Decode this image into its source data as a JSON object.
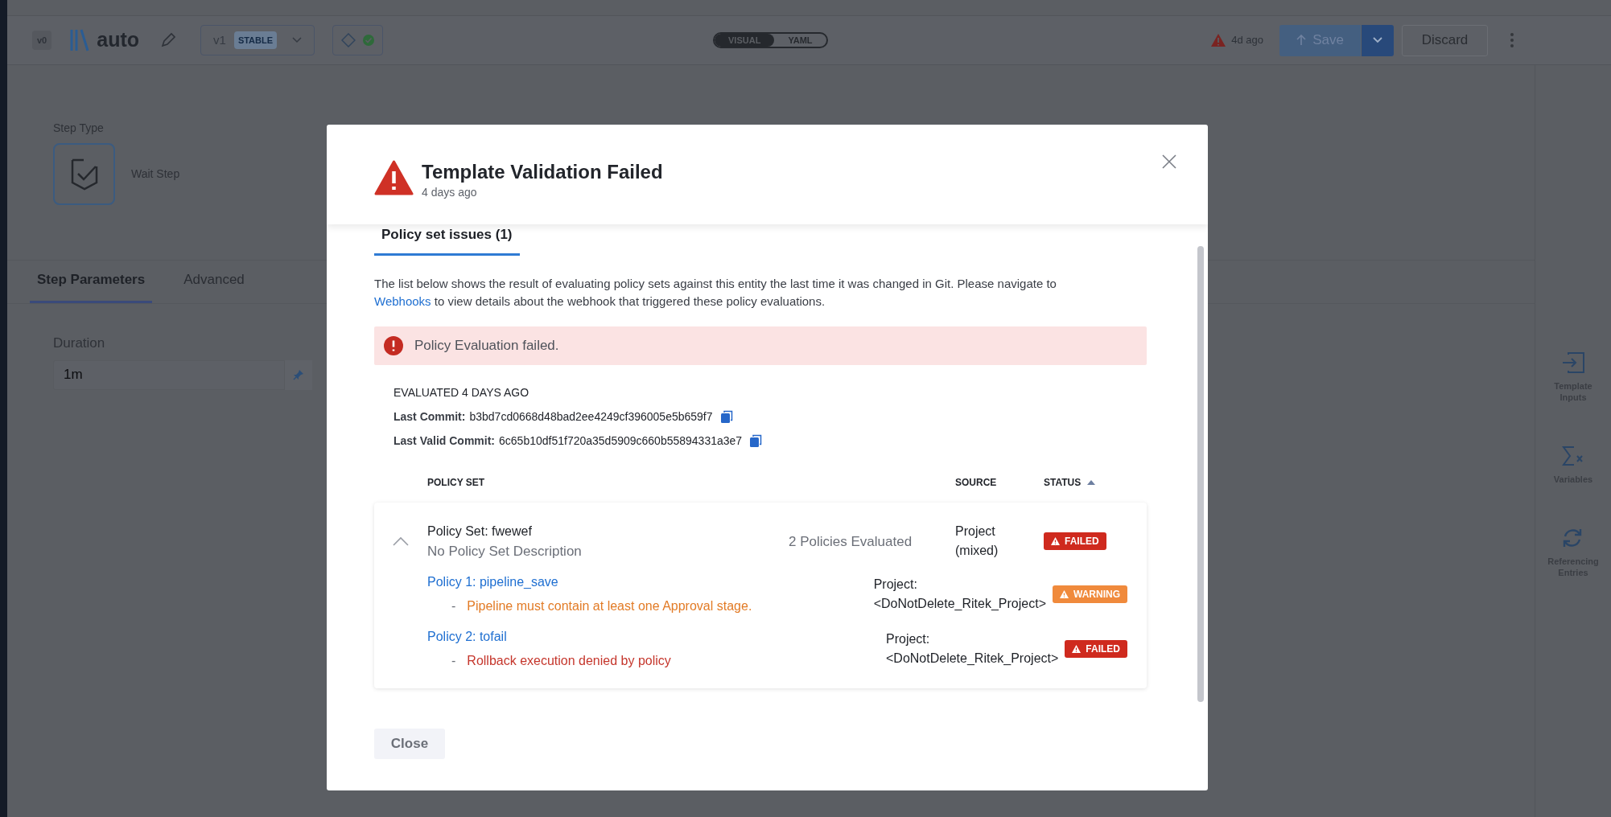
{
  "header": {
    "version_badge": "v0",
    "title": "auto",
    "version": {
      "label": "v1",
      "tag": "STABLE"
    },
    "view_toggle": [
      {
        "label": "VISUAL",
        "selected": true
      },
      {
        "label": "YAML",
        "selected": false
      }
    ],
    "warning": "4d ago",
    "save": "Save",
    "discard": "Discard"
  },
  "step": {
    "type_label": "Step Type",
    "type_name": "Wait Step"
  },
  "tabs": [
    {
      "label": "Step Parameters",
      "selected": true
    },
    {
      "label": "Advanced",
      "selected": false
    }
  ],
  "duration": {
    "label": "Duration",
    "value": "1m"
  },
  "right_panel": [
    {
      "label": "Template Inputs",
      "kind": "inputs"
    },
    {
      "label": "Variables",
      "kind": "variables"
    },
    {
      "label": "Referencing Entries",
      "kind": "refs"
    }
  ],
  "dialog": {
    "title": "Template Validation Failed",
    "subtitle": "4 days ago",
    "tabs": [
      {
        "label": "Policy set issues (1)",
        "selected": true
      }
    ],
    "description": {
      "before": "The list below shows the result of evaluating policy sets against this entity the last time it was changed in Git. Please navigate to",
      "link": "Webhooks",
      "after": "to view details about the webhook that triggered these policy evaluations."
    },
    "alert": "Policy Evaluation failed.",
    "evaluated": "EVALUATED 4 DAYS AGO",
    "commits": [
      {
        "label": "Last Commit:",
        "value": "b3bd7cd0668d48bad2ee4249cf396005e5b659f7"
      },
      {
        "label": "Last Valid Commit:",
        "value": "6c65b10df51f720a35d5909c660b55894331a3e7"
      }
    ],
    "columns": [
      {
        "label": "POLICY SET",
        "sorted": false
      },
      {
        "label": "SOURCE",
        "sorted": false
      },
      {
        "label": "STATUS",
        "sorted": true
      }
    ],
    "policy_sets": [
      {
        "name": "Policy Set: fwewef",
        "description": "No Policy Set Description",
        "expanded": true,
        "count": "2 Policies Evaluated",
        "source": "Project (mixed)",
        "status": {
          "label": "FAILED",
          "kind": "failed"
        },
        "policies": [
          {
            "name": "Policy 1: pipeline_save",
            "bullet": "-",
            "message": "Pipeline must contain at least one Approval stage.",
            "source": "Project: <DoNotDelete_Ritek_Project>",
            "status": {
              "label": "WARNING",
              "kind": "warning"
            }
          },
          {
            "name": "Policy 2: tofail",
            "bullet": "-",
            "message": "Rollback execution denied by policy",
            "source": "Project: <DoNotDelete_Ritek_Project>",
            "status": {
              "label": "FAILED",
              "kind": "failed"
            }
          }
        ]
      }
    ],
    "close": "Close"
  }
}
